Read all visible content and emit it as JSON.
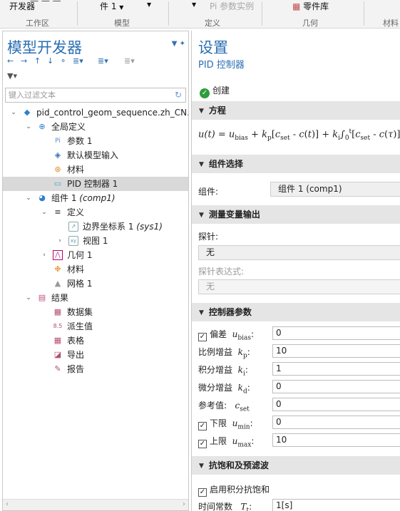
{
  "ribbon": {
    "items": [
      {
        "line1": "开发器",
        "line2": "",
        "dropdown": false
      },
      {
        "line1": "件 1",
        "line2": "",
        "dropdown": true
      },
      {
        "line1": "",
        "dropdown": true
      },
      {
        "line1": "Pi 参数实例",
        "disabled": true
      },
      {
        "line1": "零件库"
      }
    ],
    "groups": [
      "工作区",
      "模型",
      "定义",
      "几何",
      "材料"
    ]
  },
  "model_builder": {
    "title": "模型开发器",
    "filter_placeholder": "键入过滤文本",
    "tree": [
      {
        "label": "pid_control_geom_sequence.zh_CN.",
        "icon": "model-icon"
      },
      {
        "label": "全局定义",
        "icon": "globe-icon"
      },
      {
        "label": "参数 1",
        "icon": "parameters-icon"
      },
      {
        "label": "默认模型输入",
        "icon": "model-input-icon"
      },
      {
        "label": "材料",
        "icon": "materials-icon"
      },
      {
        "label": "PID 控制器 1",
        "icon": "pid-controller-icon",
        "selected": true
      },
      {
        "label": "组件 1",
        "tag": "(comp1)",
        "icon": "component-icon"
      },
      {
        "label": "定义",
        "icon": "definitions-icon"
      },
      {
        "label": "边界坐标系 1",
        "tag": "(sys1)",
        "icon": "coordinate-system-icon"
      },
      {
        "label": "视图 1",
        "icon": "view-icon"
      },
      {
        "label": "几何 1",
        "icon": "geometry-icon"
      },
      {
        "label": "材料",
        "icon": "material-icon"
      },
      {
        "label": "网格 1",
        "icon": "mesh-icon"
      },
      {
        "label": "结果",
        "icon": "results-icon"
      },
      {
        "label": "数据集",
        "icon": "dataset-icon"
      },
      {
        "label": "派生值",
        "icon": "derived-values-icon"
      },
      {
        "label": "表格",
        "icon": "table-icon"
      },
      {
        "label": "导出",
        "icon": "export-icon"
      },
      {
        "label": "报告",
        "icon": "report-icon"
      }
    ]
  },
  "settings": {
    "title": "设置",
    "subtitle": "PID 控制器",
    "build_label": "创建",
    "sections": {
      "equation": "方程",
      "component_selection": "组件选择",
      "measured_output": "测量变量输出",
      "controller_params": "控制器参数",
      "anti_windup": "抗饱和及预滤波"
    },
    "equation": {
      "lhs": "u(t)",
      "bias": "u",
      "bias_sub": "bias",
      "kp": "k",
      "kp_sub": "p",
      "cset": "c",
      "cset_sub": "set",
      "ki": "k",
      "ki_sub": "i",
      "int_from": "0",
      "int_to": "t"
    },
    "component_label": "组件:",
    "component_value": "组件 1 (comp1)",
    "probe_label": "探针:",
    "probe_value": "无",
    "probe_expr_label": "探针表达式:",
    "probe_expr_value": "无",
    "params": [
      {
        "label": "偏差",
        "sym": "u",
        "sub": "bias",
        "value": "0",
        "checkbox": true
      },
      {
        "label": "比例增益",
        "sym": "k",
        "sub": "p",
        "value": "10"
      },
      {
        "label": "积分增益",
        "sym": "k",
        "sub": "i",
        "value": "1"
      },
      {
        "label": "微分增益",
        "sym": "k",
        "sub": "d",
        "value": "0"
      },
      {
        "label": "参考值:",
        "sym": "c",
        "sub": "set",
        "value": "0"
      },
      {
        "label": "下限",
        "sym": "u",
        "sub": "min",
        "value": "0",
        "checkbox": true
      },
      {
        "label": "上限",
        "sym": "u",
        "sub": "max",
        "value": "10",
        "checkbox": true
      }
    ],
    "anti_windup_enable": "启用积分抗饱和",
    "time_constant_label": "时间常数",
    "time_constant_sym": "T",
    "time_constant_sub": "t",
    "time_constant_value": "1[s]"
  }
}
